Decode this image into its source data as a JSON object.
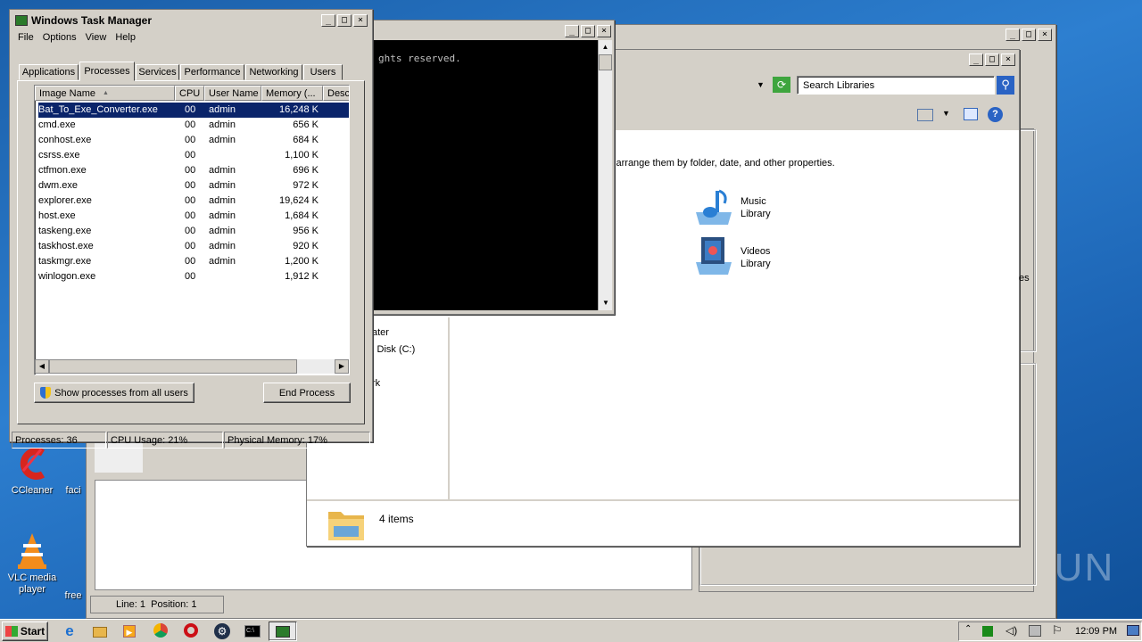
{
  "desktop": {
    "icons": [
      {
        "label": "CCleaner",
        "icon": "ccleaner-icon"
      },
      {
        "label": "faci",
        "icon": "app-icon"
      },
      {
        "label": "VLC media player",
        "icon": "vlc-icon"
      },
      {
        "label": "free",
        "icon": "app-icon"
      }
    ],
    "watermark": "ANY RUN"
  },
  "notepad": {
    "status_line": "Line: 1",
    "status_position": "Position: 1"
  },
  "explorer": {
    "search_placeholder": "Search Libraries",
    "info_text": "l arrange them by folder, date, and other properties.",
    "libraries": [
      {
        "name": "Music",
        "sub": "Library",
        "icon": "music-library-icon"
      },
      {
        "name": "Videos",
        "sub": "Library",
        "icon": "videos-library-icon"
      }
    ],
    "nav_items": [
      "ater",
      "l Disk (C:)",
      "rk"
    ],
    "items_count": "4 items",
    "side_text": "es"
  },
  "cmd": {
    "line": "ghts reserved."
  },
  "taskmgr": {
    "title": "Windows Task Manager",
    "menu": [
      "File",
      "Options",
      "View",
      "Help"
    ],
    "tabs": [
      "Applications",
      "Processes",
      "Services",
      "Performance",
      "Networking",
      "Users"
    ],
    "active_tab": "Processes",
    "columns": [
      "Image Name",
      "CPU",
      "User Name",
      "Memory (...",
      "Desc"
    ],
    "processes": [
      {
        "name": "Bat_To_Exe_Converter.exe",
        "cpu": "00",
        "user": "admin",
        "mem": "16,248 K"
      },
      {
        "name": "cmd.exe",
        "cpu": "00",
        "user": "admin",
        "mem": "656 K"
      },
      {
        "name": "conhost.exe",
        "cpu": "00",
        "user": "admin",
        "mem": "684 K"
      },
      {
        "name": "csrss.exe",
        "cpu": "00",
        "user": "",
        "mem": "1,100 K"
      },
      {
        "name": "ctfmon.exe",
        "cpu": "00",
        "user": "admin",
        "mem": "696 K"
      },
      {
        "name": "dwm.exe",
        "cpu": "00",
        "user": "admin",
        "mem": "972 K"
      },
      {
        "name": "explorer.exe",
        "cpu": "00",
        "user": "admin",
        "mem": "19,624 K"
      },
      {
        "name": "host.exe",
        "cpu": "00",
        "user": "admin",
        "mem": "1,684 K"
      },
      {
        "name": "taskeng.exe",
        "cpu": "00",
        "user": "admin",
        "mem": "956 K"
      },
      {
        "name": "taskhost.exe",
        "cpu": "00",
        "user": "admin",
        "mem": "920 K"
      },
      {
        "name": "taskmgr.exe",
        "cpu": "00",
        "user": "admin",
        "mem": "1,200 K"
      },
      {
        "name": "winlogon.exe",
        "cpu": "00",
        "user": "",
        "mem": "1,912 K"
      }
    ],
    "show_all_label": "Show processes from all users",
    "end_process_label": "End Process",
    "status": {
      "processes": "Processes: 36",
      "cpu": "CPU Usage: 21%",
      "memory": "Physical Memory: 17%"
    }
  },
  "taskbar": {
    "start_label": "Start",
    "clock": "12:09 PM",
    "apps": [
      "ie-icon",
      "explorer-icon",
      "media-player-icon",
      "chrome-icon",
      "opera-icon",
      "settings-icon",
      "cmd-icon",
      "taskmgr-icon"
    ]
  }
}
